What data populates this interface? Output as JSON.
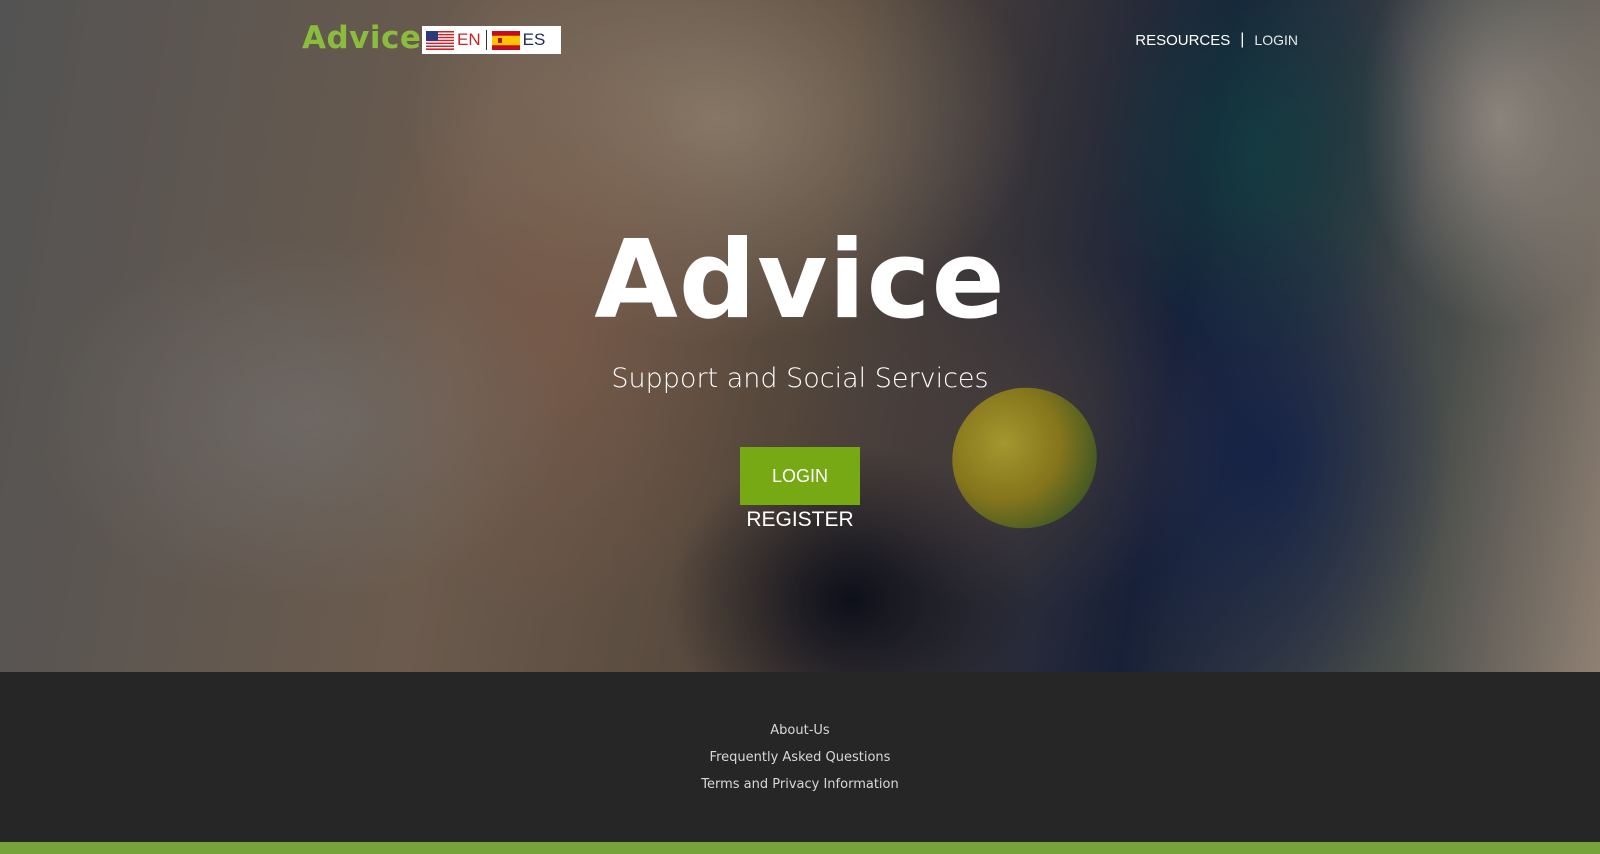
{
  "header": {
    "logo": "Advice",
    "languages": [
      {
        "code": "EN",
        "flag": "us-flag-icon"
      },
      {
        "code": "ES",
        "flag": "spain-flag-icon"
      }
    ],
    "nav": {
      "resources": "RESOURCES",
      "separator": "|",
      "login": "LOGIN"
    }
  },
  "hero": {
    "title": "Advice",
    "subtitle": "Support and Social Services",
    "login_button": "LOGIN",
    "register_link": "REGISTER"
  },
  "footer": {
    "links": [
      "About-Us",
      "Frequently Asked Questions",
      "Terms and Privacy Information"
    ]
  },
  "colors": {
    "brand_green": "#76a914",
    "logo_green": "#8bbd3d",
    "footer_bg": "#262626",
    "bottom_bar": "#76a33a"
  }
}
